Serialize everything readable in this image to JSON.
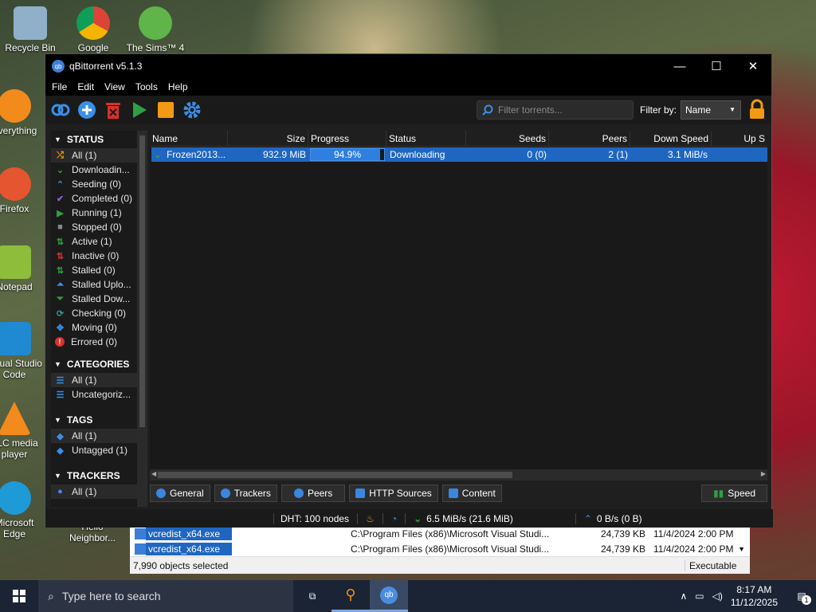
{
  "desktop": {
    "icons": [
      {
        "label": "Recycle Bin"
      },
      {
        "label": "Google"
      },
      {
        "label": "The Sims™ 4"
      },
      {
        "label": "Everything"
      },
      {
        "label": "Firefox"
      },
      {
        "label": "Notepad"
      },
      {
        "label": "Visual Studio Code"
      },
      {
        "label": "VLC media player"
      },
      {
        "label": "Microsoft Edge"
      },
      {
        "label": "Hello Neighbor..."
      }
    ]
  },
  "window": {
    "title": "qBittorrent v5.1.3"
  },
  "menu": [
    "File",
    "Edit",
    "View",
    "Tools",
    "Help"
  ],
  "toolbar": {
    "filter_placeholder": "Filter torrents...",
    "filter_by_label": "Filter by:",
    "filter_by_value": "Name"
  },
  "sidebar": {
    "status_title": "STATUS",
    "status": [
      "All (1)",
      "Downloadin...",
      "Seeding (0)",
      "Completed (0)",
      "Running (1)",
      "Stopped (0)",
      "Active (1)",
      "Inactive (0)",
      "Stalled (0)",
      "Stalled Uplo...",
      "Stalled Dow...",
      "Checking (0)",
      "Moving (0)",
      "Errored (0)"
    ],
    "categories_title": "CATEGORIES",
    "categories": [
      "All (1)",
      "Uncategoriz..."
    ],
    "tags_title": "TAGS",
    "tags": [
      "All (1)",
      "Untagged (1)"
    ],
    "trackers_title": "TRACKERS",
    "trackers": [
      "All (1)"
    ]
  },
  "table": {
    "headers": [
      "Name",
      "Size",
      "Progress",
      "Status",
      "Seeds",
      "Peers",
      "Down Speed",
      "Up S"
    ],
    "rows": [
      {
        "name": "Frozen2013...",
        "size": "932.9 MiB",
        "progress": "94.9%",
        "progress_value": 0.949,
        "status": "Downloading",
        "seeds": "0 (0)",
        "peers": "2 (1)",
        "down": "3.1 MiB/s"
      }
    ]
  },
  "tabs": [
    "General",
    "Trackers",
    "Peers",
    "HTTP Sources",
    "Content"
  ],
  "speed_label": "Speed",
  "statusbar": {
    "dht": "DHT: 100 nodes",
    "down": "6.5 MiB/s (21.6 MiB)",
    "up": "0 B/s (0 B)"
  },
  "explorer": {
    "rows": [
      {
        "name": "vcredist_x64.exe",
        "path": "C:\\Program Files (x86)\\Microsoft Visual Studi...",
        "size": "24,739 KB",
        "date": "11/4/2024 2:00 PM"
      },
      {
        "name": "vcredist_x64.exe",
        "path": "C:\\Program Files (x86)\\Microsoft Visual Studi...",
        "size": "24,739 KB",
        "date": "11/4/2024 2:00 PM"
      }
    ],
    "selected": "7,990 objects selected",
    "type": "Executable"
  },
  "taskbar": {
    "search": "Type here to search",
    "time": "8:17 AM",
    "date": "11/12/2025",
    "notif": "1"
  },
  "colors": {
    "accent": "#1f66c1",
    "green": "#2ea043",
    "red": "#d9302c",
    "orange": "#f39a12"
  }
}
